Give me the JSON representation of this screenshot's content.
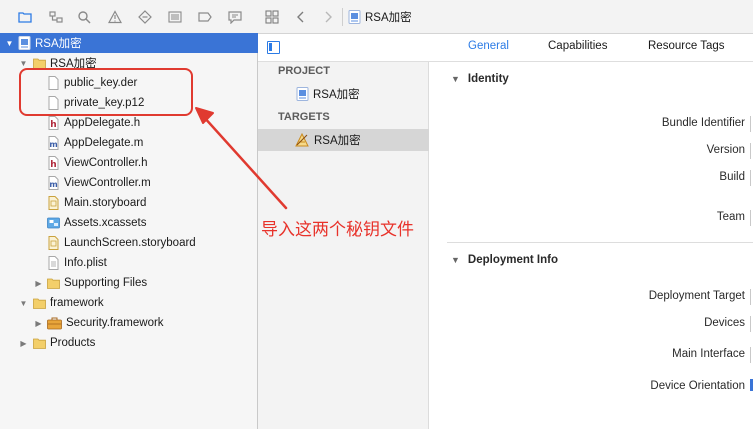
{
  "navigator": {
    "toolbar_icons": [
      "folder-icon",
      "hierarchy-icon",
      "search-icon",
      "warning-icon",
      "breakpoint-diamond-icon",
      "list-icon",
      "tag-icon",
      "comment-icon"
    ],
    "tree": [
      {
        "label": "RSA加密",
        "icon": "project-file-icon",
        "expanded": true,
        "selected": true
      },
      {
        "label": "RSA加密",
        "icon": "yellow-folder-icon",
        "expanded": true
      },
      {
        "label": "public_key.der",
        "icon": "blank-file-icon"
      },
      {
        "label": "private_key.p12",
        "icon": "blank-file-icon"
      },
      {
        "label": "AppDelegate.h",
        "icon": "header-file-icon"
      },
      {
        "label": "AppDelegate.m",
        "icon": "implementation-file-icon"
      },
      {
        "label": "ViewController.h",
        "icon": "header-file-icon"
      },
      {
        "label": "ViewController.m",
        "icon": "implementation-file-icon"
      },
      {
        "label": "Main.storyboard",
        "icon": "storyboard-file-icon"
      },
      {
        "label": "Assets.xcassets",
        "icon": "asset-catalog-icon"
      },
      {
        "label": "LaunchScreen.storyboard",
        "icon": "storyboard-file-icon"
      },
      {
        "label": "Info.plist",
        "icon": "plist-file-icon"
      },
      {
        "label": "Supporting Files",
        "icon": "yellow-folder-icon",
        "expanded": false
      },
      {
        "label": "framework",
        "icon": "yellow-folder-icon",
        "expanded": true
      },
      {
        "label": "Security.framework",
        "icon": "framework-toolbox-icon",
        "expanded": false
      },
      {
        "label": "Products",
        "icon": "yellow-folder-icon",
        "expanded": false
      }
    ]
  },
  "editor_bar": {
    "breadcrumb_label": "RSA加密"
  },
  "tabs": [
    {
      "label": "General",
      "active": true
    },
    {
      "label": "Capabilities",
      "active": false
    },
    {
      "label": "Resource Tags",
      "active": false
    }
  ],
  "target_list": {
    "project_header": "PROJECT",
    "project_item": "RSA加密",
    "targets_header": "TARGETS",
    "target_item": "RSA加密"
  },
  "settings": {
    "identity": {
      "title": "Identity",
      "fields": [
        "Bundle Identifier",
        "Version",
        "Build",
        "Team"
      ]
    },
    "deployment": {
      "title": "Deployment Info",
      "fields": [
        "Deployment Target",
        "Devices",
        "Main Interface",
        "Device Orientation"
      ]
    }
  },
  "annotation": {
    "text": "导入这两个秘钥文件",
    "color": "#e8322a"
  },
  "colors": {
    "selection": "#3a74d6",
    "accent": "#2c7be5"
  }
}
